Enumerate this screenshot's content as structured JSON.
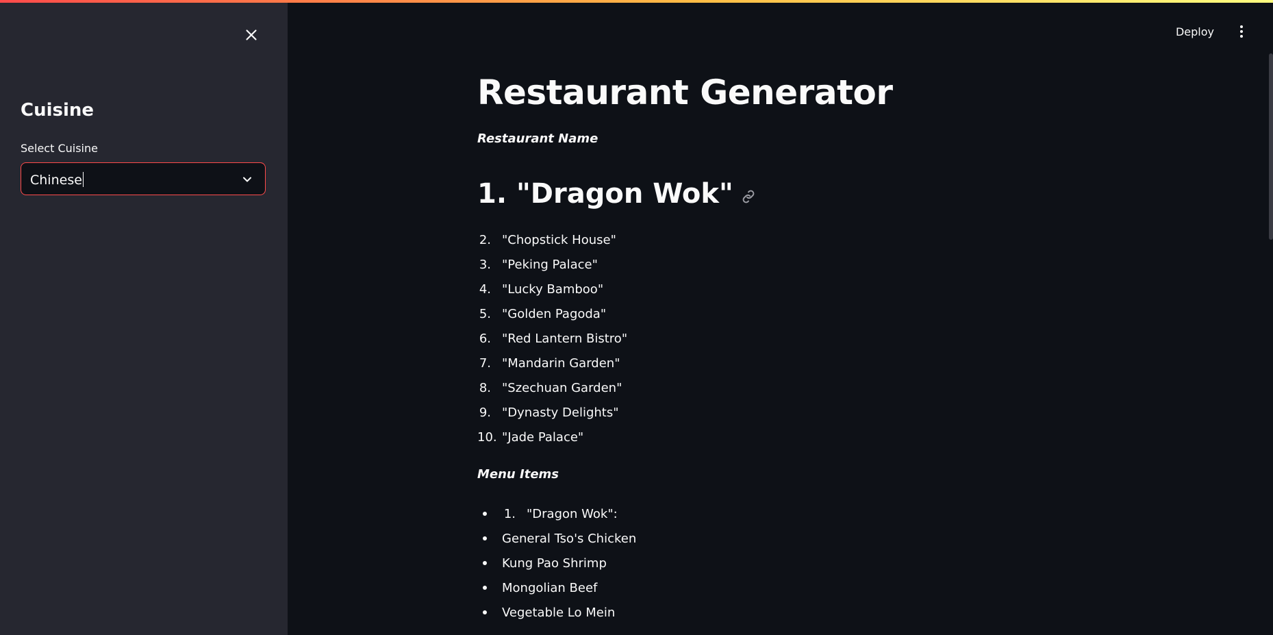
{
  "sidebar": {
    "heading": "Cuisine",
    "select_label": "Select Cuisine",
    "select_value": "Chinese"
  },
  "header": {
    "deploy_label": "Deploy"
  },
  "main": {
    "title": "Restaurant Generator",
    "restaurant_label": "Restaurant Name",
    "first_item": "1. \"Dragon Wok\"",
    "names": [
      {
        "num": "2.",
        "text": "\"Chopstick House\""
      },
      {
        "num": "3.",
        "text": "\"Peking Palace\""
      },
      {
        "num": "4.",
        "text": "\"Lucky Bamboo\""
      },
      {
        "num": "5.",
        "text": "\"Golden Pagoda\""
      },
      {
        "num": "6.",
        "text": "\"Red Lantern Bistro\""
      },
      {
        "num": "7.",
        "text": "\"Mandarin Garden\""
      },
      {
        "num": "8.",
        "text": "\"Szechuan Garden\""
      },
      {
        "num": "9.",
        "text": "\"Dynasty Delights\""
      },
      {
        "num": "10.",
        "text": "\"Jade Palace\""
      }
    ],
    "menu_label": "Menu Items",
    "menu_first": {
      "num": "1.",
      "text": "\"Dragon Wok\":"
    },
    "menu_items": [
      "General Tso's Chicken",
      "Kung Pao Shrimp",
      "Mongolian Beef",
      "Vegetable Lo Mein"
    ]
  },
  "colors": {
    "background": "#0e1117",
    "sidebar": "#262730",
    "accent": "#ff4b4b",
    "text": "#fafafa"
  }
}
